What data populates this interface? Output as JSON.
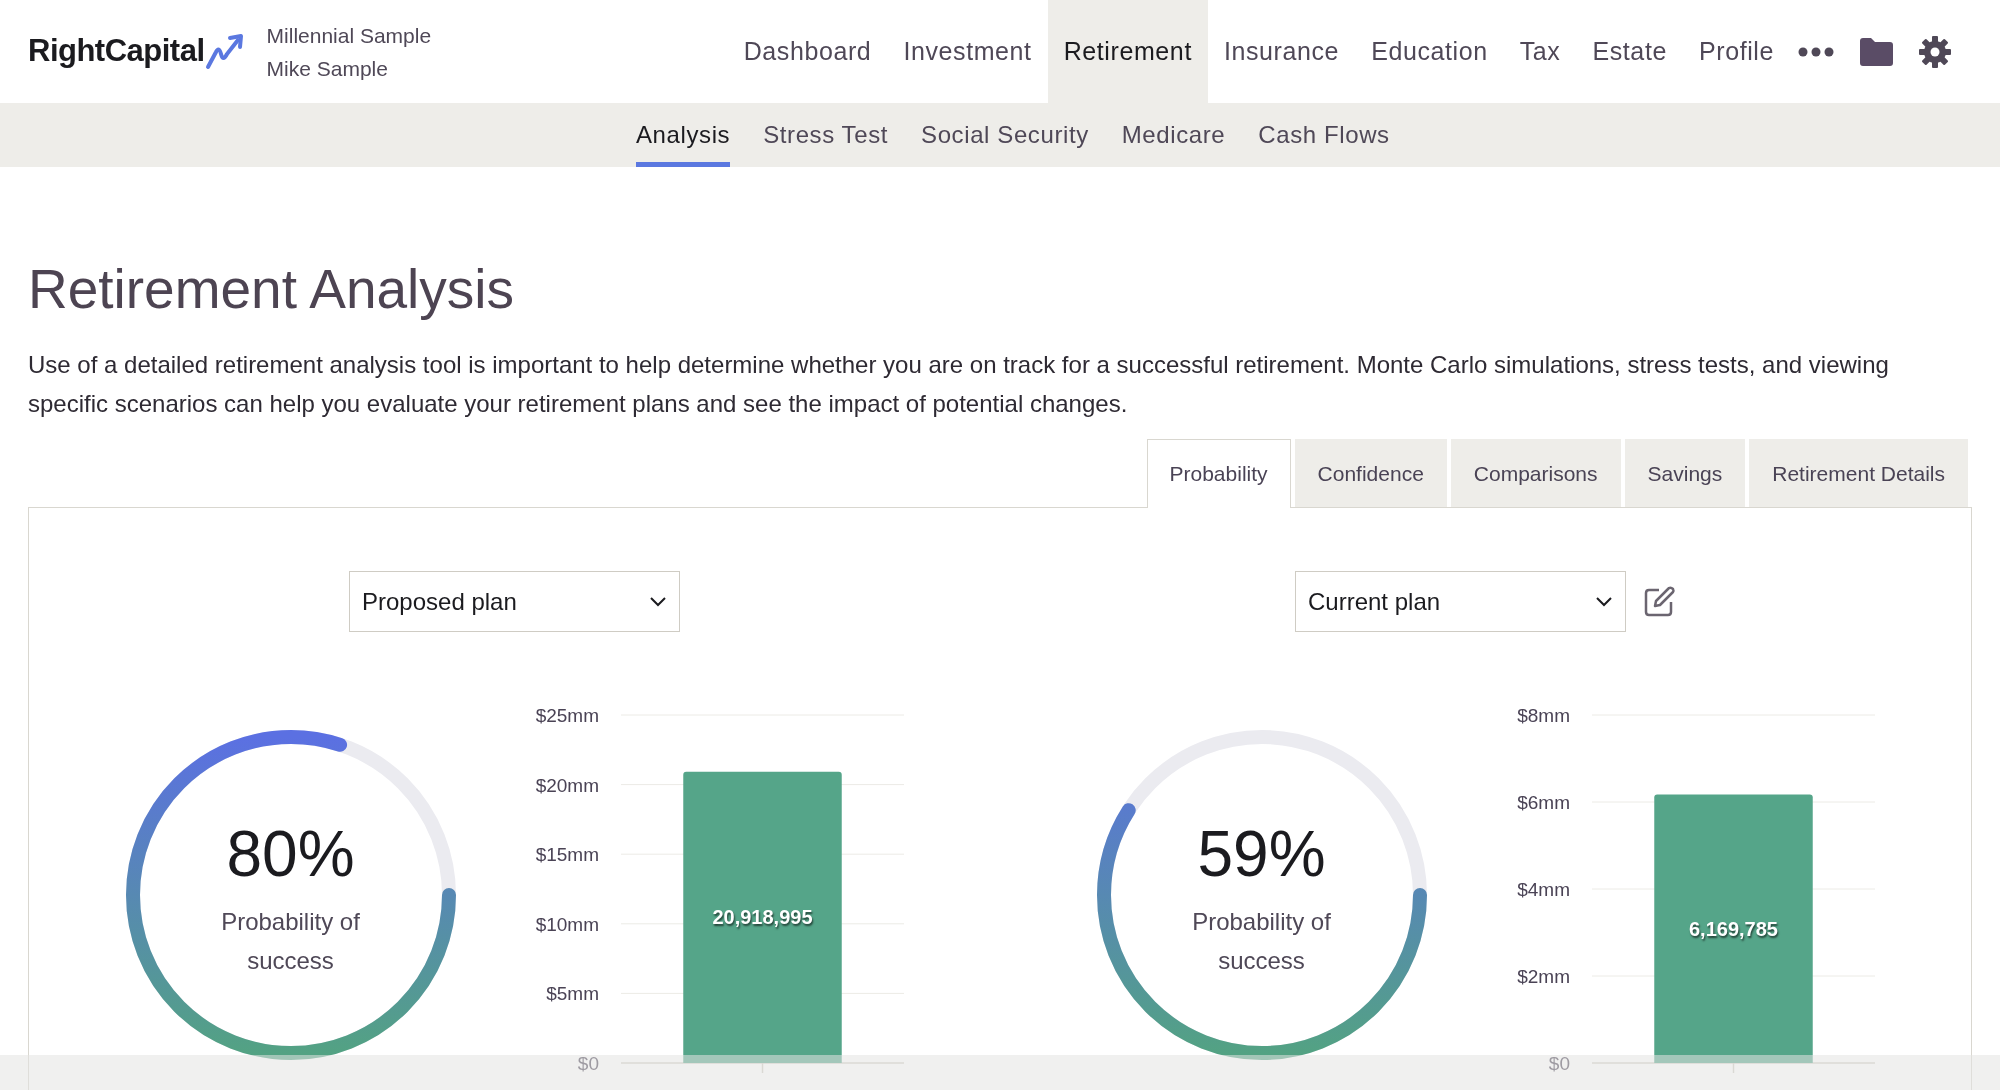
{
  "header": {
    "logo": "RightCapital",
    "client_lines": [
      "Millennial Sample",
      "Mike Sample"
    ]
  },
  "nav": [
    {
      "label": "Dashboard",
      "selected": false
    },
    {
      "label": "Investment",
      "selected": false
    },
    {
      "label": "Retirement",
      "selected": true
    },
    {
      "label": "Insurance",
      "selected": false
    },
    {
      "label": "Education",
      "selected": false
    },
    {
      "label": "Tax",
      "selected": false
    },
    {
      "label": "Estate",
      "selected": false
    },
    {
      "label": "Profile",
      "selected": false
    }
  ],
  "subnav": [
    {
      "label": "Analysis",
      "selected": true
    },
    {
      "label": "Stress Test",
      "selected": false
    },
    {
      "label": "Social Security",
      "selected": false
    },
    {
      "label": "Medicare",
      "selected": false
    },
    {
      "label": "Cash Flows",
      "selected": false
    }
  ],
  "title": "Retirement Analysis",
  "intro": "Use of a detailed retirement analysis tool is important to help determine whether you are on track for a successful retirement. Monte Carlo simulations, stress tests, and viewing specific scenarios can help you evaluate your retirement plans and see the impact of potential changes.",
  "tabs": [
    {
      "label": "Probability",
      "selected": true
    },
    {
      "label": "Confidence",
      "selected": false
    },
    {
      "label": "Comparisons",
      "selected": false
    },
    {
      "label": "Savings",
      "selected": false
    },
    {
      "label": "Retirement Details",
      "selected": false
    }
  ],
  "plans": [
    {
      "select": "Proposed plan",
      "editable": false,
      "probability": "80%",
      "level": 0.8,
      "caption": "Probability of success",
      "bar_label": "20,918,995",
      "chart_data": {
        "type": "bar",
        "values": [
          20.92
        ],
        "grid": true,
        "ylim": [
          0,
          25
        ],
        "yticks": [
          {
            "value": 0,
            "label": "$0"
          },
          {
            "value": 5,
            "label": "$5mm"
          },
          {
            "value": 10,
            "label": "$10mm"
          },
          {
            "value": 15,
            "label": "$15mm"
          },
          {
            "value": 20,
            "label": "$20mm"
          },
          {
            "value": 25,
            "label": "$25mm"
          }
        ]
      }
    },
    {
      "select": "Current plan",
      "editable": true,
      "probability": "59%",
      "level": 0.59,
      "caption": "Probability of success",
      "bar_label": "6,169,785",
      "chart_data": {
        "type": "bar",
        "values": [
          6.17
        ],
        "grid": true,
        "ylim": [
          0,
          8
        ],
        "yticks": [
          {
            "value": 0,
            "label": "$0"
          },
          {
            "value": 2,
            "label": "$2mm"
          },
          {
            "value": 4,
            "label": "$4mm"
          },
          {
            "value": 6,
            "label": "$6mm"
          },
          {
            "value": 8,
            "label": "$8mm"
          }
        ]
      }
    }
  ]
}
